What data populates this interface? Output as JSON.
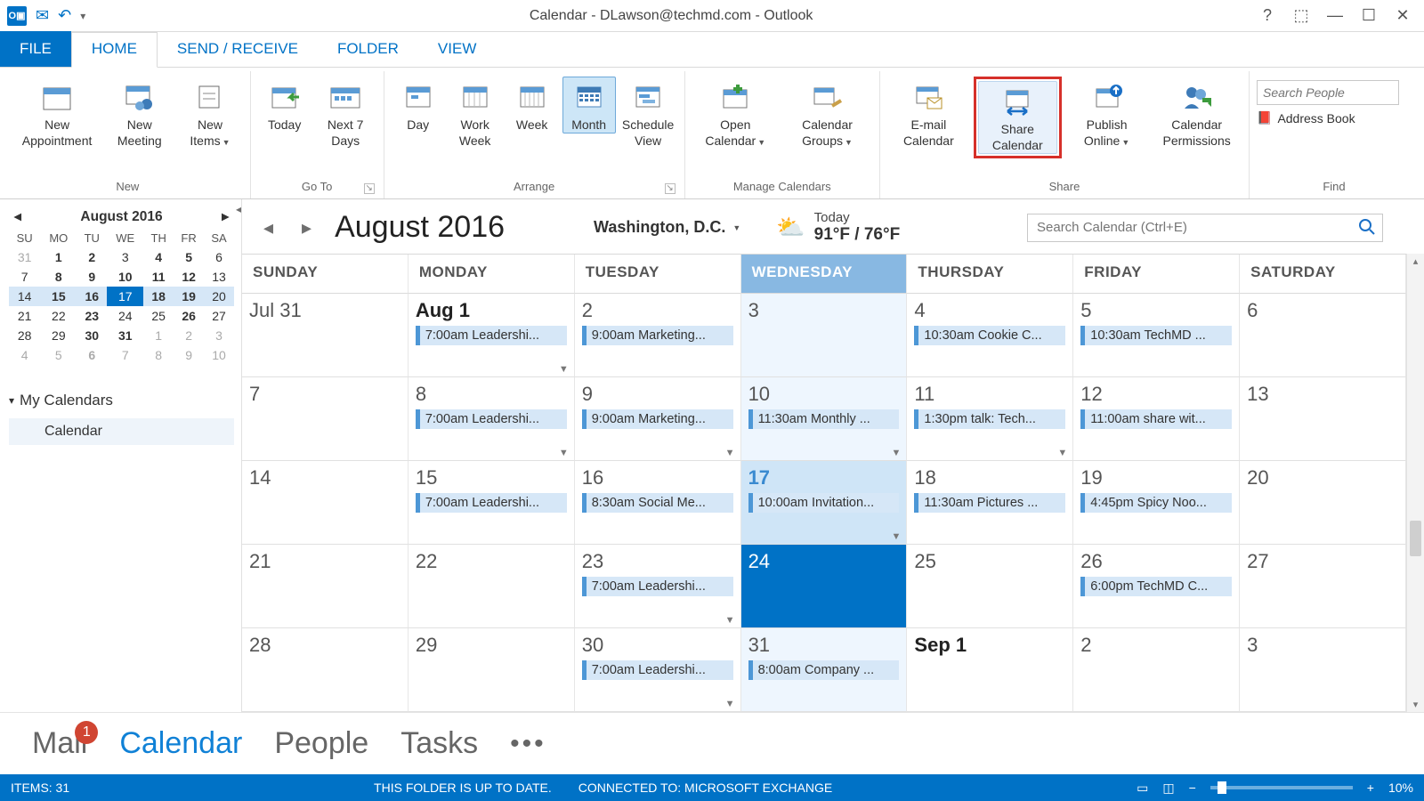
{
  "title": "Calendar - DLawson@techmd.com - Outlook",
  "tabs": {
    "file": "FILE",
    "home": "HOME",
    "sendrecv": "SEND / RECEIVE",
    "folder": "FOLDER",
    "view": "VIEW"
  },
  "ribbon": {
    "new": {
      "label": "New",
      "appt": "New Appointment",
      "meeting": "New Meeting",
      "items": "New Items"
    },
    "goto": {
      "label": "Go To",
      "today": "Today",
      "next7": "Next 7 Days"
    },
    "arrange": {
      "label": "Arrange",
      "day": "Day",
      "wweek": "Work Week",
      "week": "Week",
      "month": "Month",
      "sched": "Schedule View"
    },
    "manage": {
      "label": "Manage Calendars",
      "open": "Open Calendar",
      "groups": "Calendar Groups"
    },
    "share": {
      "label": "Share",
      "email": "E-mail Calendar",
      "share": "Share Calendar",
      "publish": "Publish Online",
      "perm": "Calendar Permissions"
    },
    "find": {
      "label": "Find",
      "search_ph": "Search People",
      "addr": "Address Book"
    }
  },
  "mini": {
    "title": "August 2016",
    "dow": [
      "SU",
      "MO",
      "TU",
      "WE",
      "TH",
      "FR",
      "SA"
    ],
    "rows": [
      [
        {
          "n": "31",
          "cls": "off"
        },
        {
          "n": "1",
          "cls": "bold"
        },
        {
          "n": "2",
          "cls": "bold"
        },
        {
          "n": "3"
        },
        {
          "n": "4",
          "cls": "bold"
        },
        {
          "n": "5",
          "cls": "bold"
        },
        {
          "n": "6"
        }
      ],
      [
        {
          "n": "7"
        },
        {
          "n": "8",
          "cls": "bold"
        },
        {
          "n": "9",
          "cls": "bold"
        },
        {
          "n": "10",
          "cls": "bold"
        },
        {
          "n": "11",
          "cls": "bold"
        },
        {
          "n": "12",
          "cls": "bold"
        },
        {
          "n": "13"
        }
      ],
      [
        {
          "n": "14",
          "cls": "hl"
        },
        {
          "n": "15",
          "cls": "bold hl"
        },
        {
          "n": "16",
          "cls": "bold hl"
        },
        {
          "n": "17",
          "cls": "today"
        },
        {
          "n": "18",
          "cls": "bold hl"
        },
        {
          "n": "19",
          "cls": "bold hl"
        },
        {
          "n": "20",
          "cls": "hl"
        }
      ],
      [
        {
          "n": "21"
        },
        {
          "n": "22"
        },
        {
          "n": "23",
          "cls": "bold"
        },
        {
          "n": "24"
        },
        {
          "n": "25"
        },
        {
          "n": "26",
          "cls": "bold"
        },
        {
          "n": "27"
        }
      ],
      [
        {
          "n": "28"
        },
        {
          "n": "29"
        },
        {
          "n": "30",
          "cls": "bold"
        },
        {
          "n": "31",
          "cls": "bold"
        },
        {
          "n": "1",
          "cls": "off"
        },
        {
          "n": "2",
          "cls": "off"
        },
        {
          "n": "3",
          "cls": "off"
        }
      ],
      [
        {
          "n": "4",
          "cls": "off"
        },
        {
          "n": "5",
          "cls": "off"
        },
        {
          "n": "6",
          "cls": "off bold"
        },
        {
          "n": "7",
          "cls": "off"
        },
        {
          "n": "8",
          "cls": "off"
        },
        {
          "n": "9",
          "cls": "off"
        },
        {
          "n": "10",
          "cls": "off"
        }
      ]
    ]
  },
  "mycals": {
    "heading": "My Calendars",
    "item": "Calendar"
  },
  "mainhead": {
    "month": "August 2016",
    "loc": "Washington, D.C.",
    "today_lbl": "Today",
    "temps": "91°F / 76°F",
    "search_ph": "Search Calendar (Ctrl+E)"
  },
  "dow": [
    "SUNDAY",
    "MONDAY",
    "TUESDAY",
    "WEDNESDAY",
    "THURSDAY",
    "FRIDAY",
    "SATURDAY"
  ],
  "weeks": [
    [
      {
        "n": "Jul 31"
      },
      {
        "n": "Aug 1",
        "bold": true,
        "e": "7:00am Leadershi...",
        "more": true
      },
      {
        "n": "2",
        "e": "9:00am Marketing..."
      },
      {
        "n": "3",
        "today": true
      },
      {
        "n": "4",
        "e": "10:30am Cookie C..."
      },
      {
        "n": "5",
        "e": "10:30am TechMD ..."
      },
      {
        "n": "6"
      }
    ],
    [
      {
        "n": "7"
      },
      {
        "n": "8",
        "e": "7:00am Leadershi...",
        "more": true
      },
      {
        "n": "9",
        "e": "9:00am Marketing...",
        "more": true
      },
      {
        "n": "10",
        "today": true,
        "e": "11:30am Monthly ...",
        "more": true
      },
      {
        "n": "11",
        "e": "1:30pm talk: Tech...",
        "more": true
      },
      {
        "n": "12",
        "e": "11:00am share wit..."
      },
      {
        "n": "13"
      }
    ],
    [
      {
        "n": "14"
      },
      {
        "n": "15",
        "e": "7:00am Leadershi..."
      },
      {
        "n": "16",
        "e": "8:30am Social Me..."
      },
      {
        "n": "17",
        "today": true,
        "istoday": true,
        "e": "10:00am Invitation...",
        "more": true
      },
      {
        "n": "18",
        "e": "11:30am Pictures ..."
      },
      {
        "n": "19",
        "e": "4:45pm Spicy Noo..."
      },
      {
        "n": "20"
      }
    ],
    [
      {
        "n": "21"
      },
      {
        "n": "22"
      },
      {
        "n": "23",
        "e": "7:00am Leadershi...",
        "more": true
      },
      {
        "n": "24",
        "today": true,
        "selected": true
      },
      {
        "n": "25"
      },
      {
        "n": "26",
        "e": "6:00pm TechMD C..."
      },
      {
        "n": "27"
      }
    ],
    [
      {
        "n": "28"
      },
      {
        "n": "29"
      },
      {
        "n": "30",
        "e": "7:00am Leadershi...",
        "more": true
      },
      {
        "n": "31",
        "today": true,
        "e": "8:00am Company ..."
      },
      {
        "n": "Sep 1",
        "bold": true
      },
      {
        "n": "2"
      },
      {
        "n": "3"
      }
    ]
  ],
  "footer": {
    "mail": "Mail",
    "cal": "Calendar",
    "people": "People",
    "tasks": "Tasks",
    "badge": "1"
  },
  "status": {
    "items": "ITEMS: 31",
    "folder": "THIS FOLDER IS UP TO DATE.",
    "conn": "CONNECTED TO: MICROSOFT EXCHANGE",
    "zoom": "10%"
  }
}
